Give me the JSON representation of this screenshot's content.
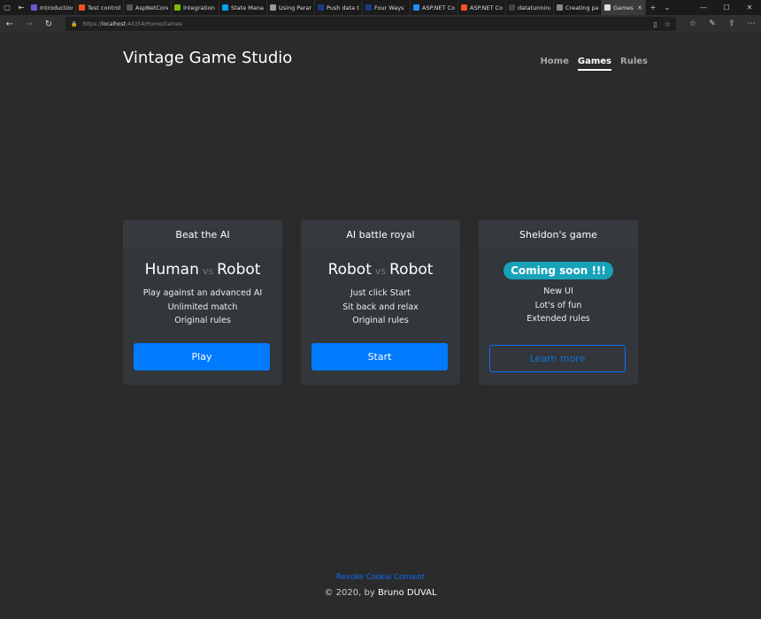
{
  "browser": {
    "tabs": [
      {
        "label": "Introduction",
        "color": "#6a5acd"
      },
      {
        "label": "Test control",
        "color": "#f25022"
      },
      {
        "label": "AspNetCore",
        "color": "#555555"
      },
      {
        "label": "Integration",
        "color": "#7fba00"
      },
      {
        "label": "State Mana",
        "color": "#00a4ef"
      },
      {
        "label": "Using Parar",
        "color": "#999999"
      },
      {
        "label": "Push data t",
        "color": "#1e3a8a"
      },
      {
        "label": "Four Ways",
        "color": "#1e3a8a"
      },
      {
        "label": "ASP.NET Co",
        "color": "#1e90ff"
      },
      {
        "label": "ASP.NET Co",
        "color": "#f25022"
      },
      {
        "label": "datatunning",
        "color": "#444444"
      },
      {
        "label": "Creating pa",
        "color": "#888888"
      },
      {
        "label": "Games",
        "color": "#dddddd"
      }
    ],
    "url_scheme": "https://",
    "url_host": "localhost",
    "url_path": ":44354/Home/Games"
  },
  "site": {
    "brand": "Vintage Game Studio",
    "nav": [
      {
        "label": "Home"
      },
      {
        "label": "Games"
      },
      {
        "label": "Rules"
      }
    ]
  },
  "cards": [
    {
      "title": "Beat the AI",
      "left": "Human",
      "vs": "vs",
      "right": "Robot",
      "features": [
        "Play against an advanced AI",
        "Unlimited match",
        "Original rules"
      ],
      "button": "Play"
    },
    {
      "title": "AI battle royal",
      "left": "Robot",
      "vs": "vs",
      "right": "Robot",
      "features": [
        "Just click Start",
        "Sit back and relax",
        "Original rules"
      ],
      "button": "Start"
    },
    {
      "title": "Sheldon's game",
      "badge": "Coming soon !!!",
      "features": [
        "New UI",
        "Lot's of fun",
        "Extended rules"
      ],
      "button": "Learn more"
    }
  ],
  "footer": {
    "consent": "Revoke Cookie Consent",
    "copy_prefix": "© 2020, by",
    "author": "Bruno DUVAL"
  },
  "colors": {
    "background": "#2b2b2b",
    "card": "#33363a",
    "primary": "#007bff",
    "badge": "#17a2b8"
  }
}
